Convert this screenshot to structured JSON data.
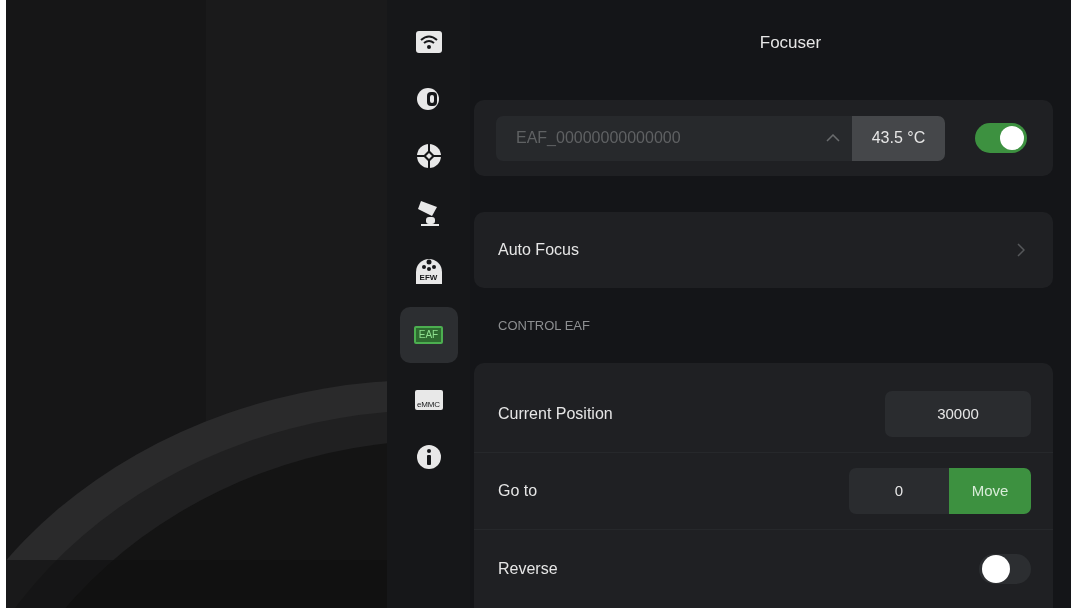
{
  "sidebar": {
    "items": [
      {
        "kind": "wifi",
        "selected": false
      },
      {
        "kind": "camera",
        "selected": false
      },
      {
        "kind": "guide",
        "selected": false
      },
      {
        "kind": "mount",
        "selected": false
      },
      {
        "kind": "efw",
        "label": "EFW",
        "selected": false
      },
      {
        "kind": "eaf",
        "label": "EAF",
        "selected": true
      },
      {
        "kind": "emmc",
        "label": "eMMC",
        "selected": false
      },
      {
        "kind": "info",
        "selected": false
      }
    ]
  },
  "title": "Focuser",
  "device": {
    "name": "EAF_00000000000000",
    "temperature": "43.5 °C",
    "on": true
  },
  "auto_focus": {
    "label": "Auto Focus"
  },
  "section_title": "CONTROL EAF",
  "controls": [
    {
      "kind": "value",
      "label": "Current Position",
      "value": "30000"
    },
    {
      "kind": "goto",
      "label": "Go to",
      "value": "0",
      "button": "Move"
    },
    {
      "kind": "toggle",
      "label": "Reverse",
      "on": false
    }
  ]
}
